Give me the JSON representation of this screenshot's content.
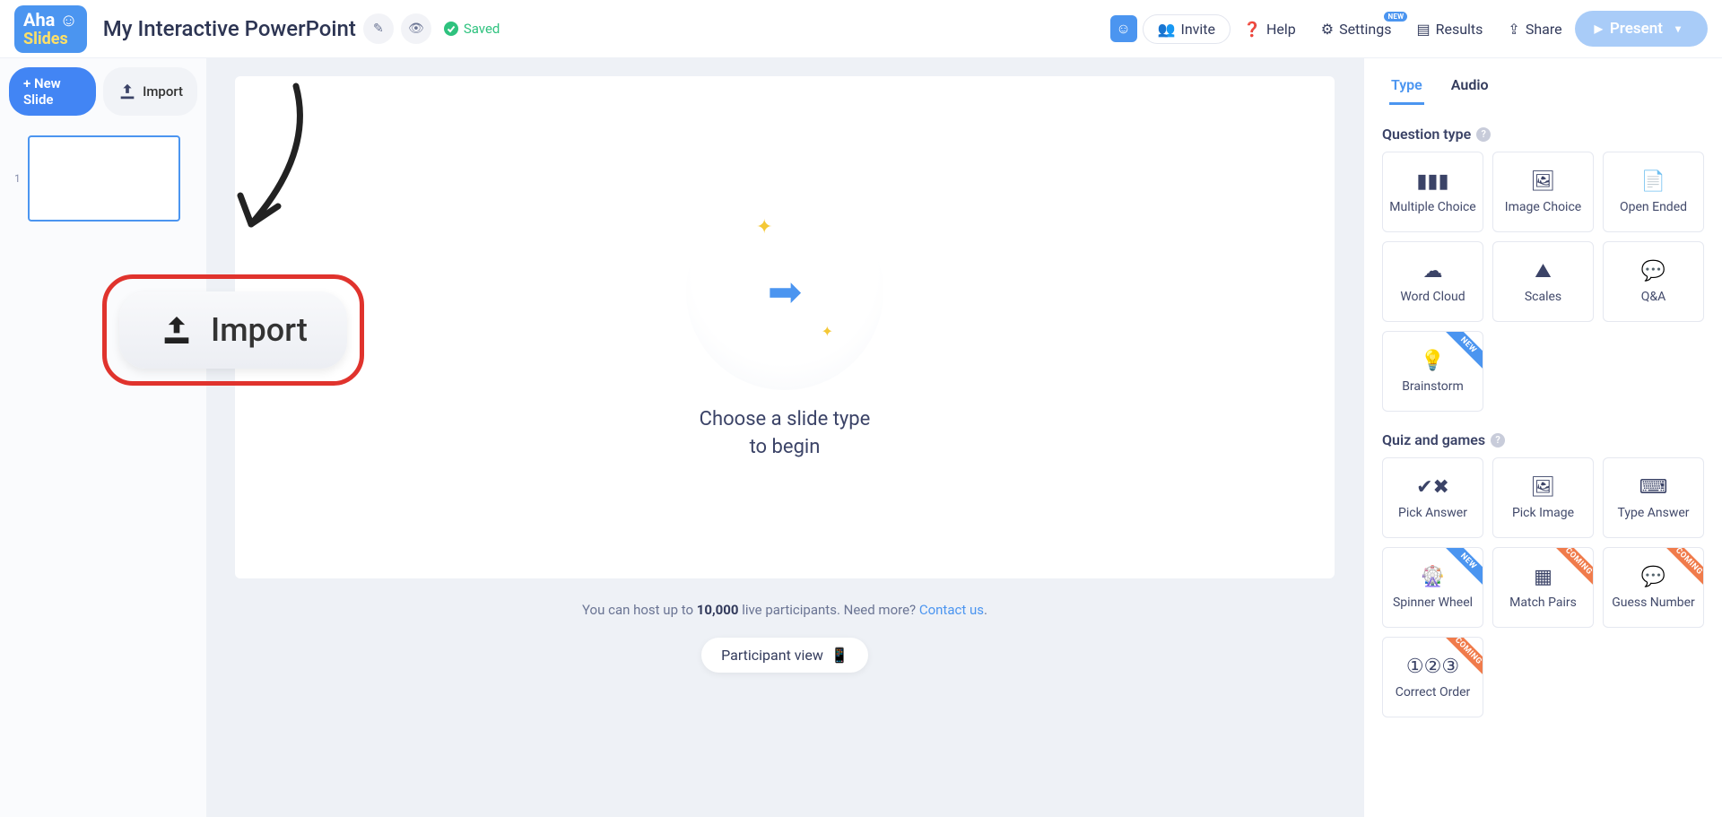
{
  "header": {
    "logo_top": "Aha ☺",
    "logo_bot": "Slides",
    "title": "My Interactive PowerPoint",
    "saved": "Saved",
    "invite": "Invite",
    "help": "Help",
    "settings": "Settings",
    "settings_badge": "NEW",
    "results": "Results",
    "share": "Share",
    "present": "Present"
  },
  "sidebar": {
    "new_slide": "+ New Slide",
    "import": "Import",
    "slide_index": "1"
  },
  "overlay": {
    "import_big": "Import"
  },
  "canvas": {
    "choose_line1": "Choose a slide type",
    "choose_line2": "to begin",
    "hint_pre": "You can host up to ",
    "hint_num": "10,000",
    "hint_mid": " live participants. Need more? ",
    "hint_link": "Contact us",
    "hint_post": ".",
    "participant_view": "Participant view"
  },
  "right": {
    "tab_type": "Type",
    "tab_audio": "Audio",
    "section_question": "Question type",
    "section_quiz": "Quiz and games",
    "badge_new": "NEW",
    "badge_coming": "COMING",
    "q": {
      "mc": "Multiple Choice",
      "ic": "Image Choice",
      "oe": "Open Ended",
      "wc": "Word Cloud",
      "sc": "Scales",
      "qa": "Q&A",
      "bs": "Brainstorm"
    },
    "g": {
      "pa": "Pick Answer",
      "pi": "Pick Image",
      "ta": "Type Answer",
      "sw": "Spinner Wheel",
      "mp": "Match Pairs",
      "gn": "Guess Number",
      "co": "Correct Order"
    }
  }
}
